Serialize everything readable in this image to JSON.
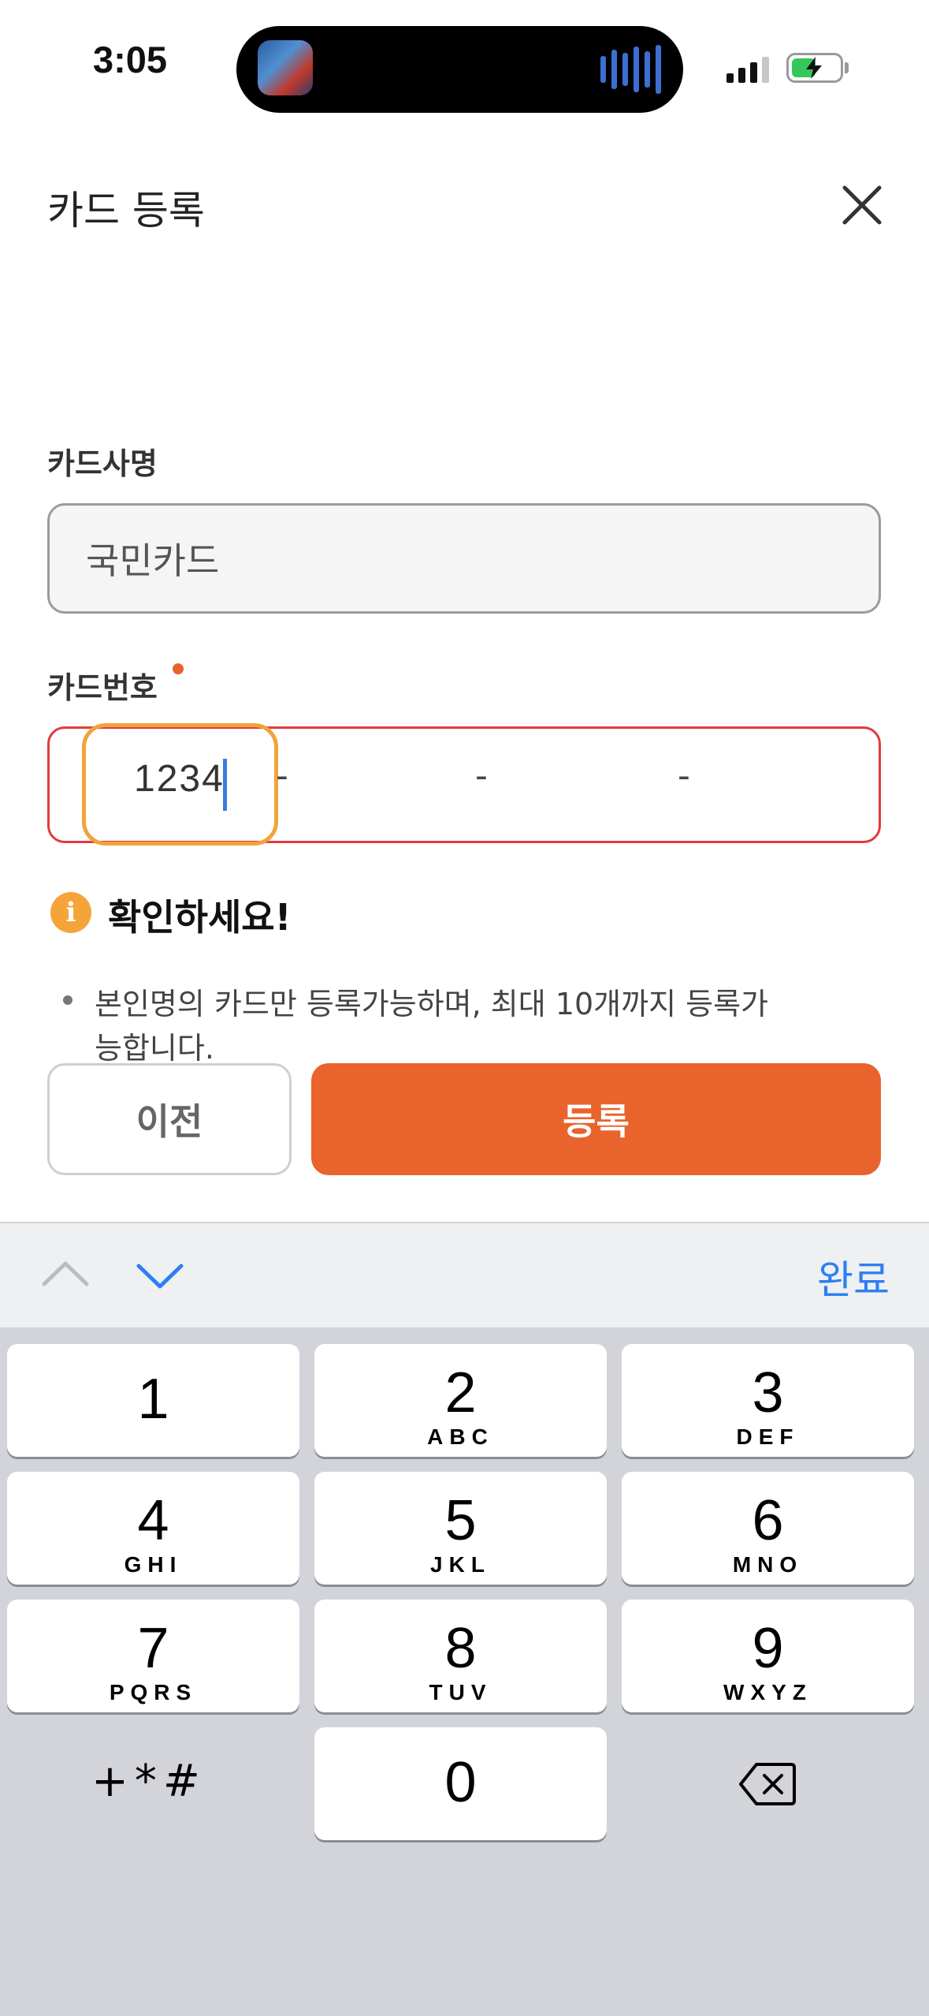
{
  "status_bar": {
    "time": "3:05"
  },
  "header": {
    "title": "카드 등록"
  },
  "form": {
    "company_label": "카드사명",
    "company_value": "국민카드",
    "card_number_label": "카드번호",
    "card_segments": [
      "1234",
      "",
      "",
      ""
    ],
    "separator": "-"
  },
  "notice": {
    "title": "확인하세요!",
    "icon_glyph": "i",
    "text": "본인명의 카드만 등록가능하며, 최대 10개까지 등록가능합니다."
  },
  "buttons": {
    "prev": "이전",
    "submit": "등록"
  },
  "keyboard": {
    "done": "완료",
    "keys": [
      {
        "num": "1",
        "letters": ""
      },
      {
        "num": "2",
        "letters": "ABC"
      },
      {
        "num": "3",
        "letters": "DEF"
      },
      {
        "num": "4",
        "letters": "GHI"
      },
      {
        "num": "5",
        "letters": "JKL"
      },
      {
        "num": "6",
        "letters": "MNO"
      },
      {
        "num": "7",
        "letters": "PQRS"
      },
      {
        "num": "8",
        "letters": "TUV"
      },
      {
        "num": "9",
        "letters": "WXYZ"
      },
      {
        "num": "0",
        "letters": ""
      }
    ],
    "symbols": "+*#"
  },
  "colors": {
    "accent": "#e9632c",
    "error_border": "#e23b3b",
    "focus_ring": "#f2a33a",
    "link_blue": "#2d7ff0"
  }
}
